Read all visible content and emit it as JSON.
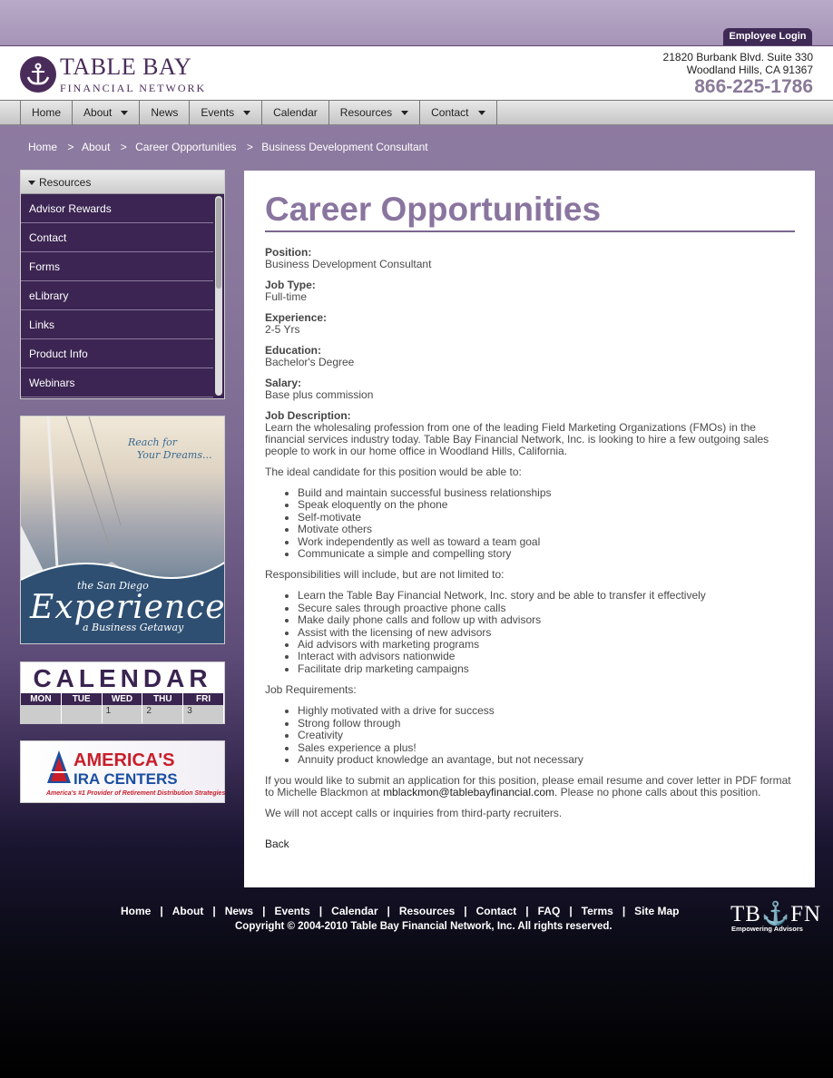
{
  "header": {
    "employee_login": "Employee Login",
    "logo_title": "TABLE BAY",
    "logo_subtitle": "FINANCIAL NETWORK",
    "address_line1": "21820 Burbank Blvd. Suite 330",
    "address_line2": "Woodland Hills, CA 91367",
    "phone": "866-225-1786"
  },
  "nav": {
    "items": [
      {
        "label": "Home",
        "dropdown": false
      },
      {
        "label": "About",
        "dropdown": true
      },
      {
        "label": "News",
        "dropdown": false
      },
      {
        "label": "Events",
        "dropdown": true
      },
      {
        "label": "Calendar",
        "dropdown": false
      },
      {
        "label": "Resources",
        "dropdown": true
      },
      {
        "label": "Contact",
        "dropdown": true
      }
    ]
  },
  "breadcrumb": [
    "Home",
    "About",
    "Career Opportunities",
    "Business Development Consultant"
  ],
  "breadcrumb_sep": ">",
  "sidebar": {
    "heading": "Resources",
    "items": [
      "Advisor Rewards",
      "Contact",
      "Forms",
      "eLibrary",
      "Links",
      "Product Info",
      "Webinars"
    ]
  },
  "promo": {
    "reach_line1": "Reach for",
    "reach_line2": "Your Dreams...",
    "the_san_diego": "the San Diego",
    "experience": "Experience",
    "getaway": "a Business Getaway"
  },
  "calendar": {
    "title": "CALENDAR",
    "days": [
      "MON",
      "TUE",
      "WED",
      "THU",
      "FRI"
    ],
    "numbers": [
      "",
      "",
      "1",
      "2",
      "3"
    ]
  },
  "ira": {
    "line1": "AMERICA'S",
    "line2": "IRA CENTERS",
    "tagline": "America's #1 Provider of Retirement Distribution Strategies"
  },
  "content": {
    "title": "Career Opportunities",
    "fields": [
      {
        "label": "Position:",
        "value": "Business Development Consultant"
      },
      {
        "label": "Job Type:",
        "value": "Full-time"
      },
      {
        "label": "Experience:",
        "value": "2-5 Yrs"
      },
      {
        "label": "Education:",
        "value": "Bachelor's Degree"
      },
      {
        "label": "Salary:",
        "value": "Base plus commission"
      }
    ],
    "job_description_label": "Job Description:",
    "job_description": "Learn the wholesaling profession from one of the leading Field Marketing Organizations (FMOs) in the financial services industry today. Table Bay Financial Network, Inc. is looking to hire a few outgoing sales people to work in our home office in Woodland Hills, California.",
    "ideal_intro": "The ideal candidate for this position would be able to:",
    "ideal_list": [
      "Build and maintain successful business relationships",
      "Speak eloquently on the phone",
      "Self-motivate",
      "Motivate others",
      "Work independently as well as toward a team goal",
      "Communicate a simple and compelling story"
    ],
    "resp_intro": "Responsibilities will include, but are not limited to:",
    "resp_list": [
      "Learn the Table Bay Financial Network, Inc. story and be able to transfer it effectively",
      "Secure sales through proactive phone calls",
      "Make daily phone calls and follow up with advisors",
      "Assist with the licensing of new advisors",
      "Aid advisors with marketing programs",
      "Interact with advisors nationwide",
      "Facilitate drip marketing campaigns"
    ],
    "req_intro": "Job Requirements:",
    "req_list": [
      "Highly motivated with a drive for success",
      "Strong follow through",
      "Creativity",
      "Sales experience a plus!",
      "Annuity product knowledge an avantage, but not necessary"
    ],
    "apply_text_pre": "If you would like to submit an application for this position, please email resume and cover letter in PDF format to Michelle Blackmon at ",
    "apply_email": "mblackmon@tablebayfinancial.com",
    "apply_text_post": ". Please no phone calls about this position.",
    "recruiters": "We will not accept calls or inquiries from third-party recruiters.",
    "back": "Back"
  },
  "footer": {
    "links": [
      "Home",
      "About",
      "News",
      "Events",
      "Calendar",
      "Resources",
      "Contact",
      "FAQ",
      "Terms",
      "Site Map"
    ],
    "separator": "|",
    "copyright": "Copyright © 2004-2010 Table Bay Financial Network, Inc. All rights reserved.",
    "logo": "TB⚓FN",
    "logo_tagline": "Empowering Advisors"
  },
  "colors": {
    "brand_purple": "#4a2c5a",
    "heading_purple": "#8a759f",
    "sidebar_bg": "#3a2450"
  }
}
